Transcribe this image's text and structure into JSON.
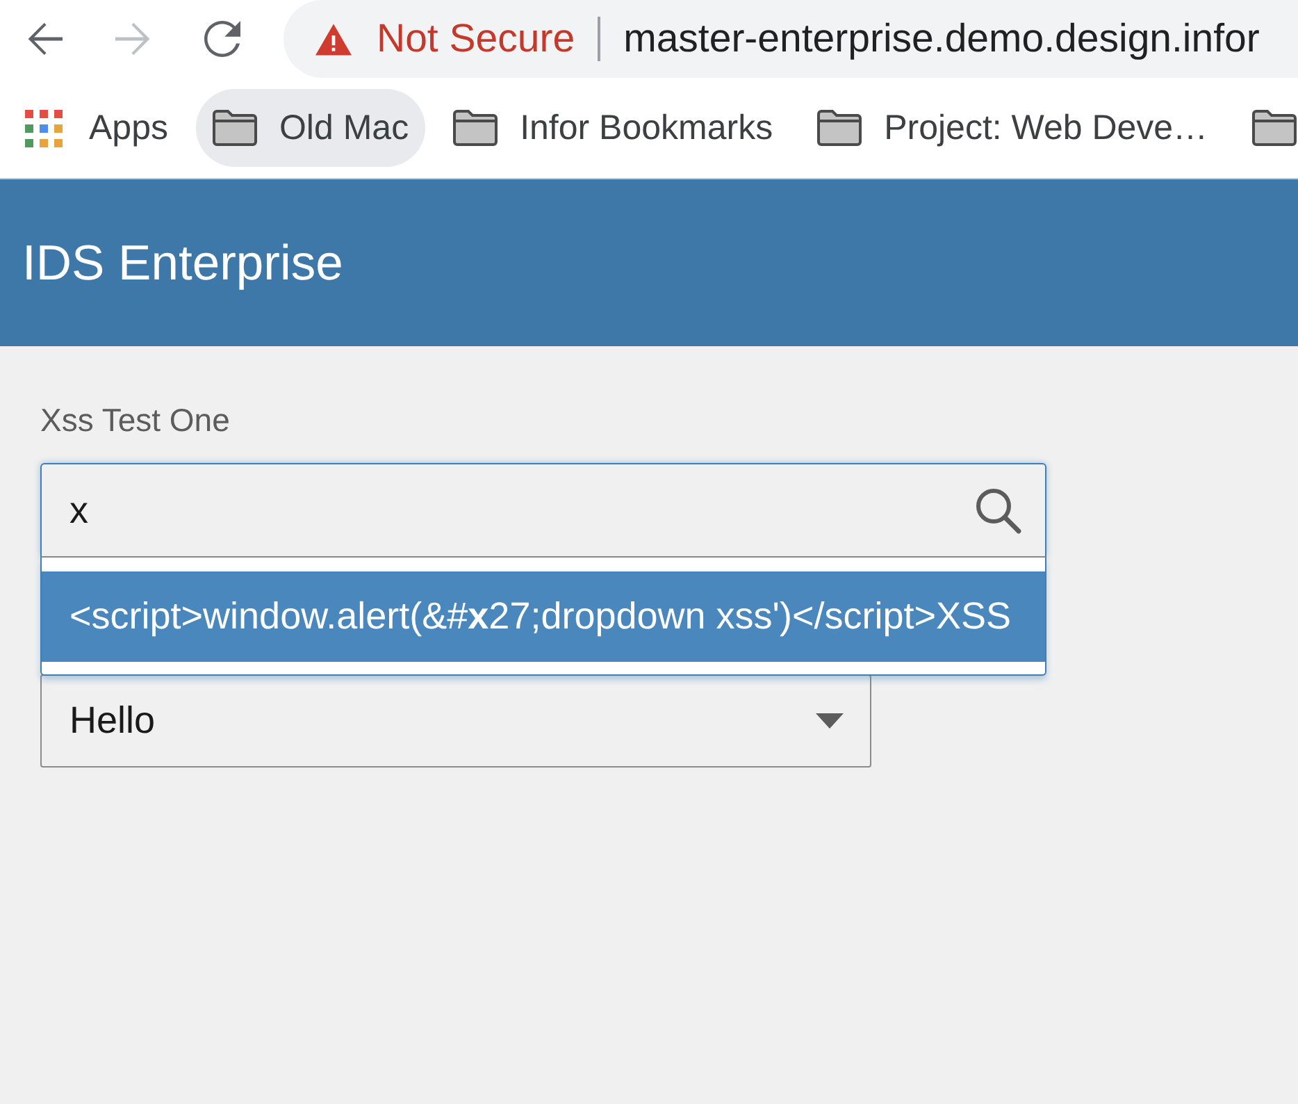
{
  "browser": {
    "nav_buttons": [
      {
        "kind": "back",
        "disabled": false
      },
      {
        "kind": "forward",
        "disabled": true
      },
      {
        "kind": "reload",
        "disabled": false
      }
    ],
    "address_bar": {
      "security_label": "Not Secure",
      "url": "master-enterprise.demo.design.infor"
    },
    "bookmarks": [
      {
        "kind": "apps",
        "label": "Apps",
        "selected": false
      },
      {
        "kind": "folder",
        "label": "Old Mac",
        "selected": true
      },
      {
        "kind": "folder",
        "label": "Infor Bookmarks",
        "selected": false
      },
      {
        "kind": "folder",
        "label": "Project: Web Deve…",
        "selected": false
      },
      {
        "kind": "folder",
        "selected": false
      }
    ]
  },
  "header": {
    "title": "IDS Enterprise"
  },
  "page": {
    "fields": [
      {
        "kind": "autocomplete",
        "label": "Xss Test One",
        "value": "x",
        "expanded": true,
        "options": [
          {
            "label": "<script>window.alert(&#**x**27;dropdown xss')</script>XSS",
            "selected": true
          }
        ]
      },
      {
        "kind": "dropdown",
        "value": "Hello"
      }
    ]
  }
}
